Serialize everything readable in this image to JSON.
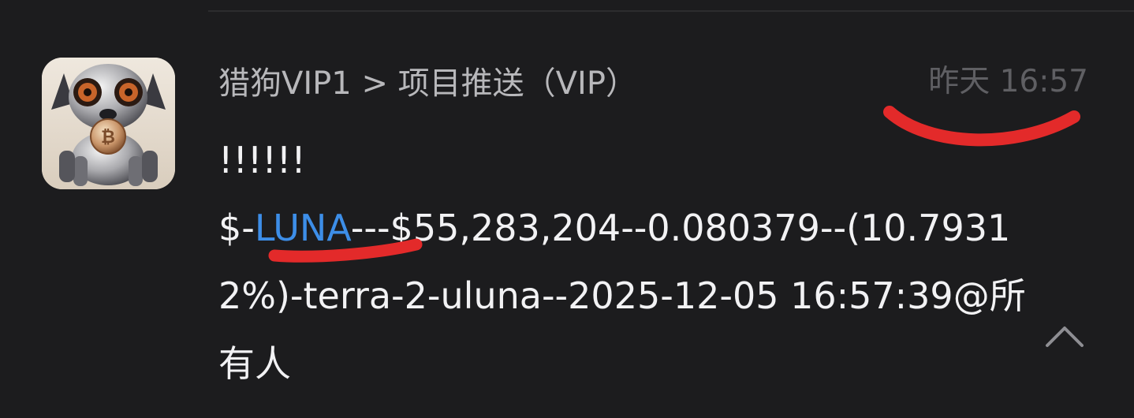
{
  "notification": {
    "sender": "猎狗VIP1 > 项目推送（VIP）",
    "time": "昨天 16:57",
    "message": {
      "prefix": "!!!!!!",
      "pre_ticker": "$-",
      "ticker": "LUNA",
      "body": "---$55,283,204--0.080379--(10.79312%)-terra-2-uluna--2025-12-05 16:57:39@所有人"
    }
  },
  "icons": {
    "avatar": "robot-dog-bitcoin-avatar",
    "collapse": "chevron-up-icon"
  },
  "colors": {
    "background": "#1c1c1e",
    "ticker": "#3d8ee8",
    "annotation": "#e32a2a"
  }
}
